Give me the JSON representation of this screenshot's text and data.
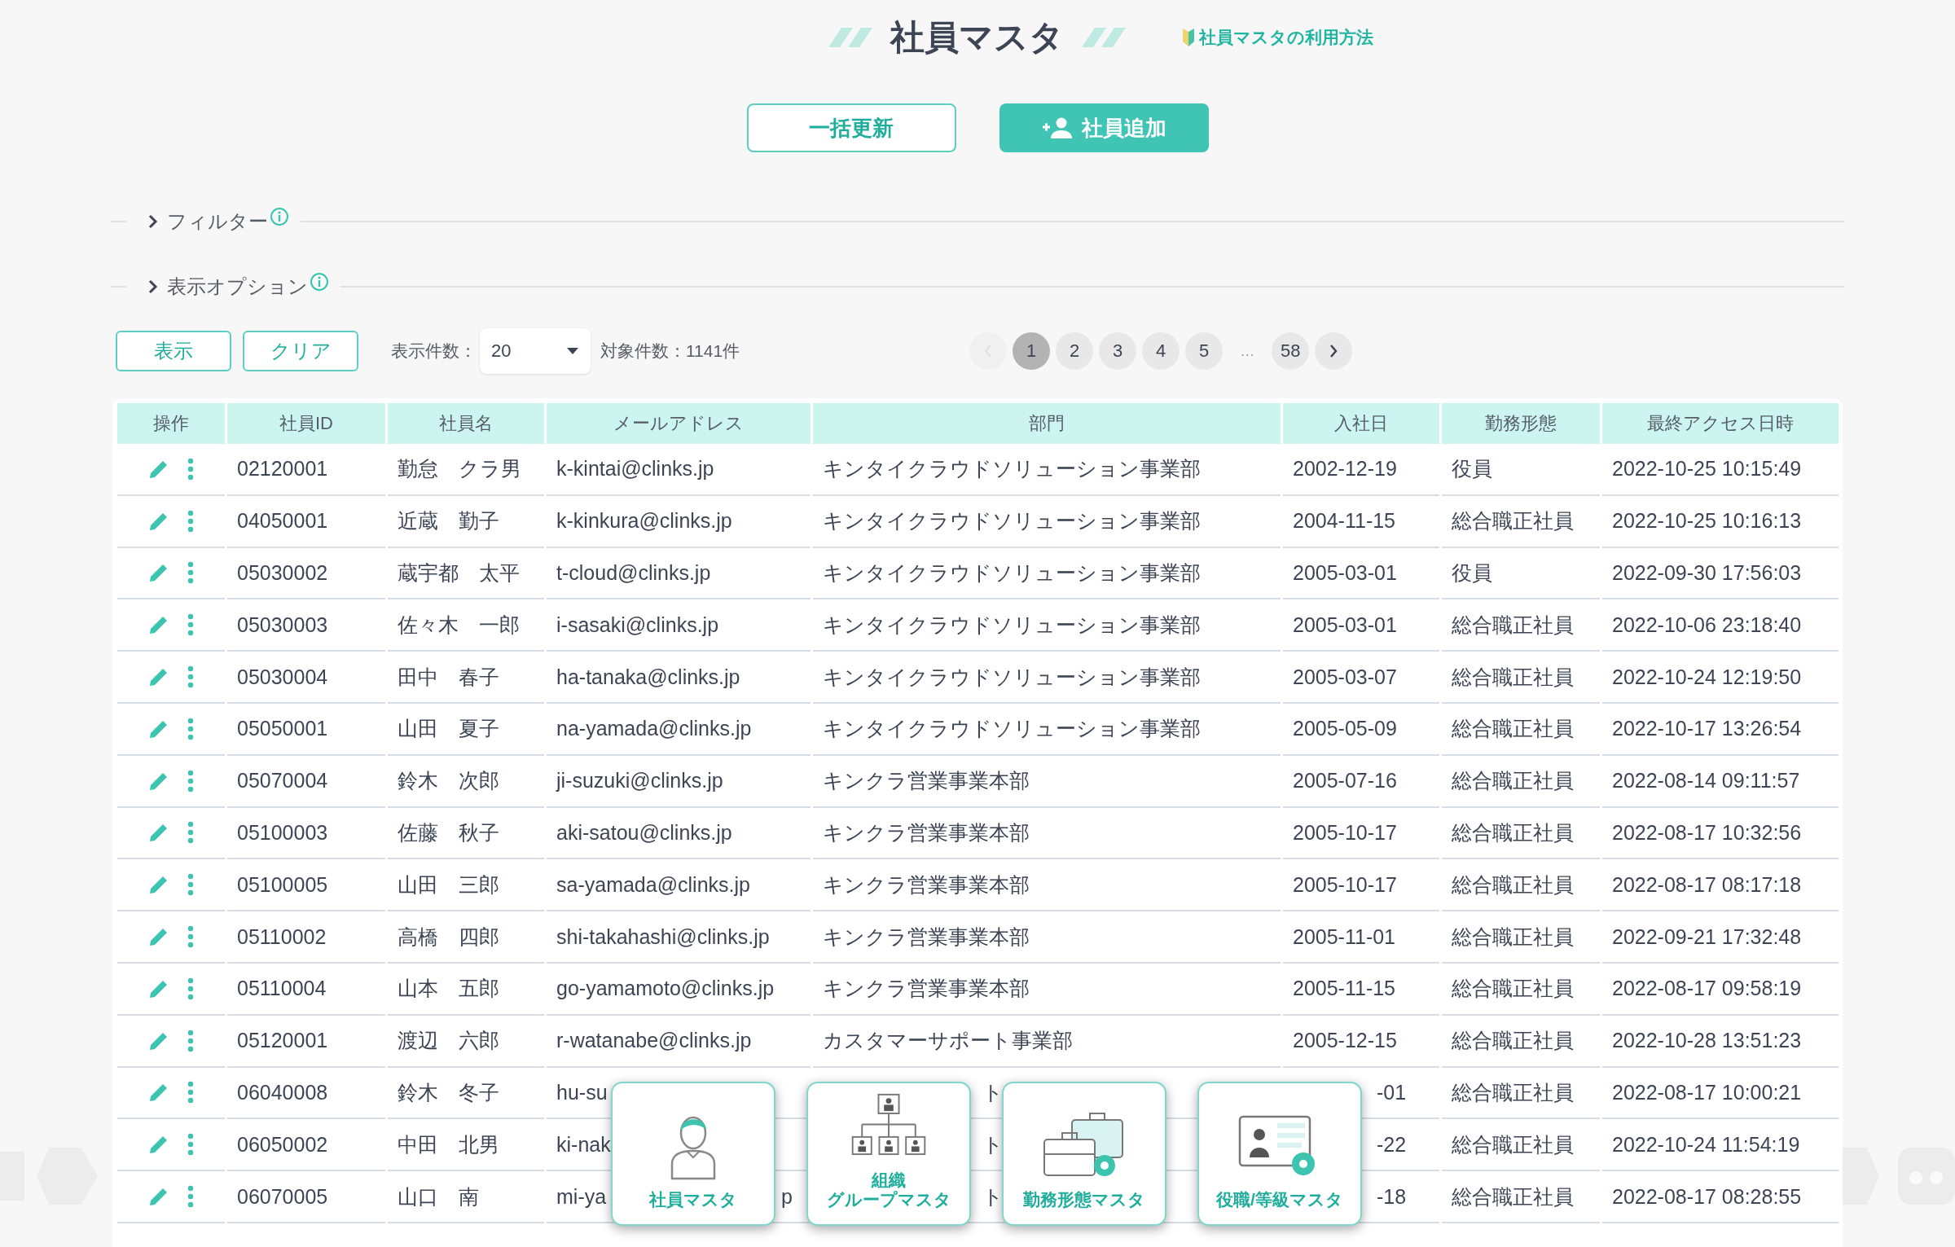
{
  "title": "社員マスタ",
  "help_link": "社員マスタの利用方法",
  "actions": [
    {
      "label": "一括更新",
      "kind": "outline"
    },
    {
      "label": "社員追加",
      "kind": "primary"
    }
  ],
  "sections": [
    {
      "label": "フィルター",
      "expanded": false
    },
    {
      "label": "表示オプション",
      "expanded": false
    }
  ],
  "controls": {
    "buttons": [
      "表示",
      "クリア"
    ],
    "page_size_label": "表示件数：",
    "page_size": "20",
    "total": "対象件数：1141件"
  },
  "pagination": {
    "prev_disabled": true,
    "items": [
      {
        "kind": "page",
        "label": "1",
        "selected": true
      },
      {
        "kind": "page",
        "label": "2",
        "selected": false
      },
      {
        "kind": "page",
        "label": "3",
        "selected": false
      },
      {
        "kind": "page",
        "label": "4",
        "selected": false
      },
      {
        "kind": "page",
        "label": "5",
        "selected": false
      },
      {
        "kind": "ellipsis",
        "label": "…"
      },
      {
        "kind": "page",
        "label": "58",
        "selected": false
      }
    ]
  },
  "table": {
    "columns": [
      "操作",
      "社員ID",
      "社員名",
      "メールアドレス",
      "部門",
      "入社日",
      "勤務形態",
      "最終アクセス日時"
    ],
    "rows": [
      {
        "id": "02120001",
        "name": "勤怠　クラ男",
        "email": "k-kintai@clinks.jp",
        "department": "キンタイクラウドソリューション事業部",
        "joined": "2002-12-19",
        "type": "役員",
        "last_access": "2022-10-25 10:15:49"
      },
      {
        "id": "04050001",
        "name": "近蔵　勤子",
        "email": "k-kinkura@clinks.jp",
        "department": "キンタイクラウドソリューション事業部",
        "joined": "2004-11-15",
        "type": "総合職正社員",
        "last_access": "2022-10-25 10:16:13"
      },
      {
        "id": "05030002",
        "name": "蔵宇都　太平",
        "email": "t-cloud@clinks.jp",
        "department": "キンタイクラウドソリューション事業部",
        "joined": "2005-03-01",
        "type": "役員",
        "last_access": "2022-09-30 17:56:03"
      },
      {
        "id": "05030003",
        "name": "佐々木　一郎",
        "email": "i-sasaki@clinks.jp",
        "department": "キンタイクラウドソリューション事業部",
        "joined": "2005-03-01",
        "type": "総合職正社員",
        "last_access": "2022-10-06 23:18:40"
      },
      {
        "id": "05030004",
        "name": "田中　春子",
        "email": "ha-tanaka@clinks.jp",
        "department": "キンタイクラウドソリューション事業部",
        "joined": "2005-03-07",
        "type": "総合職正社員",
        "last_access": "2022-10-24 12:19:50"
      },
      {
        "id": "05050001",
        "name": "山田　夏子",
        "email": "na-yamada@clinks.jp",
        "department": "キンタイクラウドソリューション事業部",
        "joined": "2005-05-09",
        "type": "総合職正社員",
        "last_access": "2022-10-17 13:26:54"
      },
      {
        "id": "05070004",
        "name": "鈴木　次郎",
        "email": "ji-suzuki@clinks.jp",
        "department": "キンクラ営業事業本部",
        "joined": "2005-07-16",
        "type": "総合職正社員",
        "last_access": "2022-08-14 09:11:57"
      },
      {
        "id": "05100003",
        "name": "佐藤　秋子",
        "email": "aki-satou@clinks.jp",
        "department": "キンクラ営業事業本部",
        "joined": "2005-10-17",
        "type": "総合職正社員",
        "last_access": "2022-08-17 10:32:56"
      },
      {
        "id": "05100005",
        "name": "山田　三郎",
        "email": "sa-yamada@clinks.jp",
        "department": "キンクラ営業事業本部",
        "joined": "2005-10-17",
        "type": "総合職正社員",
        "last_access": "2022-08-17 08:17:18"
      },
      {
        "id": "05110002",
        "name": "高橋　四郎",
        "email": "shi-takahashi@clinks.jp",
        "department": "キンクラ営業事業本部",
        "joined": "2005-11-01",
        "type": "総合職正社員",
        "last_access": "2022-09-21 17:32:48"
      },
      {
        "id": "05110004",
        "name": "山本　五郎",
        "email": "go-yamamoto@clinks.jp",
        "department": "キンクラ営業事業本部",
        "joined": "2005-11-15",
        "type": "総合職正社員",
        "last_access": "2022-08-17 09:58:19"
      },
      {
        "id": "05120001",
        "name": "渡辺　六郎",
        "email": "r-watanabe@clinks.jp",
        "department": "カスタマーサポート事業部",
        "joined": "2005-12-15",
        "type": "総合職正社員",
        "last_access": "2022-10-28 13:51:23"
      },
      {
        "id": "06040008",
        "name": "鈴木　冬子",
        "email": "hu-su",
        "department_tail": "ト",
        "joined_tail": "-01",
        "type": "総合職正社員",
        "last_access": "2022-08-17 10:00:21"
      },
      {
        "id": "06050002",
        "name": "中田　北男",
        "email": "ki-nak",
        "department_tail": "ト",
        "joined_tail": "-22",
        "type": "総合職正社員",
        "last_access": "2022-10-24 11:54:19"
      },
      {
        "id": "06070005",
        "name": "山口　南",
        "email": "mi-ya",
        "email_tail": "p",
        "department_tail": "ト",
        "joined_tail": "-18",
        "type": "総合職正社員",
        "last_access": "2022-08-17 08:28:55"
      }
    ]
  },
  "dock": [
    {
      "label_lines": [
        "社員マスタ"
      ],
      "kind": "person"
    },
    {
      "label_lines": [
        "組織",
        "グループマスタ"
      ],
      "kind": "org"
    },
    {
      "label_lines": [
        "勤務形態マスタ"
      ],
      "kind": "briefcase"
    },
    {
      "label_lines": [
        "役職/等級マスタ"
      ],
      "kind": "idcard"
    }
  ]
}
